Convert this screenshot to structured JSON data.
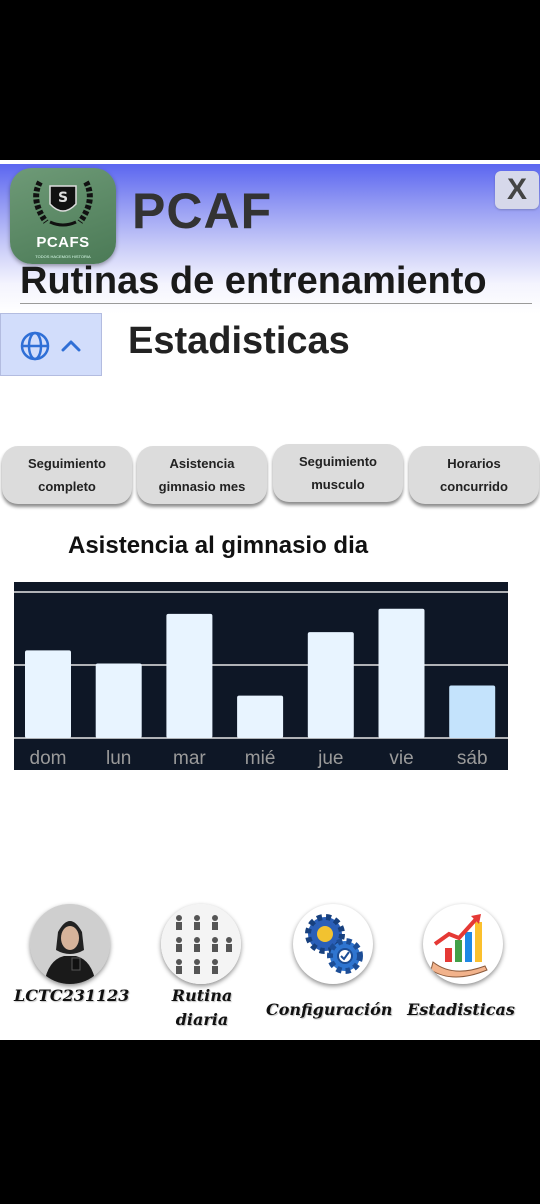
{
  "header": {
    "logo_text": "PCAFS",
    "logo_subtext": "TODOS HACEMOS HISTORIA",
    "app_title": "PCAF",
    "close_label": "X",
    "subtitle": "Rutinas de entrenamiento"
  },
  "language_selector": {
    "icon": "globe-icon",
    "chevron": "chevron-up-icon"
  },
  "section_title": "Estadisticas",
  "tabs": [
    {
      "label_line1": "Seguimiento",
      "label_line2": "completo"
    },
    {
      "label_line1": "Asistencia",
      "label_line2": "gimnasio mes"
    },
    {
      "label_line1": "Seguimiento",
      "label_line2": "musculo"
    },
    {
      "label_line1": "Horarios",
      "label_line2": "concurrido"
    }
  ],
  "chart_title": "Asistencia al gimnasio dia",
  "chart_data": {
    "type": "bar",
    "title": "Asistencia al gimnasio dia",
    "categories": [
      "dom",
      "lun",
      "mar",
      "mié",
      "jue",
      "vie",
      "sáb"
    ],
    "values": [
      12,
      10.2,
      17,
      5.8,
      14.5,
      17.7,
      7.2
    ],
    "ylim": [
      0,
      20
    ],
    "gridlines": [
      10,
      20
    ],
    "highlighted_category": "sáb",
    "colors": {
      "background": "#0e1726",
      "bar": "#e8f4ff",
      "bar_highlight": "#c4e3fc",
      "grid": "#e6e6e6",
      "tick": "#9a9a9a"
    }
  },
  "bottom_nav": [
    {
      "label": "LCTC231123",
      "icon": "user-avatar"
    },
    {
      "label": "Rutina diaria",
      "icon": "exercise-sheet-icon"
    },
    {
      "label": "Configuración",
      "icon": "gears-icon"
    },
    {
      "label": "Estadisticas",
      "icon": "growth-chart-icon"
    }
  ],
  "colors": {
    "header_gradient_top": "#5b66f0",
    "tab_bg": "#dcdcdc",
    "lang_bg": "#d2ddfb",
    "accent_blue": "#2f6fd6"
  }
}
